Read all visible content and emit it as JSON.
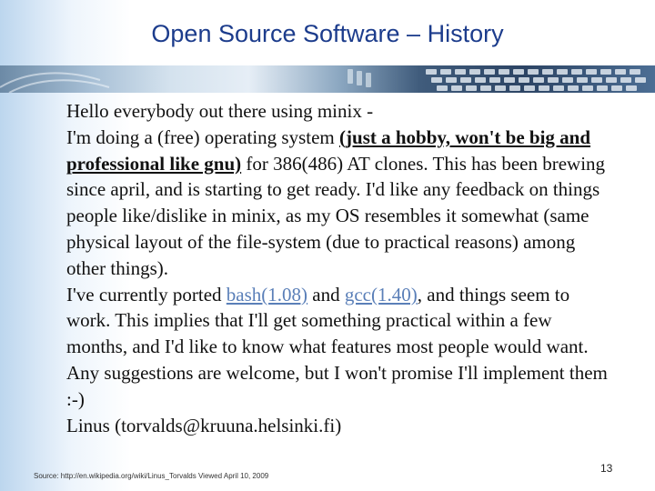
{
  "slide": {
    "title": "Open Source Software – History",
    "quote": {
      "l1": "Hello everybody out there using minix -",
      "l2_pre": "I'm doing a (free) operating system ",
      "highlight": "(just a hobby, won't be big and professional like gnu)",
      "l2_post": " for 386(486) AT clones. This has been brewing since april, and is starting to get ready. I'd like any feedback on things people like/dislike in minix, as my OS resembles it somewhat (same physical layout of the file-system (due to practical reasons) among other things).",
      "l3_pre": "I've currently ported ",
      "link_bash": "bash(1.08)",
      "l3_mid": " and ",
      "link_gcc": "gcc(1.40)",
      "l3_post": ", and things seem to work. This implies that I'll get something practical within a few months, and I'd like to know what features most people would want. Any suggestions are welcome, but I won't promise I'll implement them :-)",
      "signature": "Linus (torvalds@kruuna.helsinki.fi)"
    },
    "source": "Source: http://en.wikipedia.org/wiki/Linus_Torvalds Viewed April 10, 2009",
    "page_number": "13"
  }
}
